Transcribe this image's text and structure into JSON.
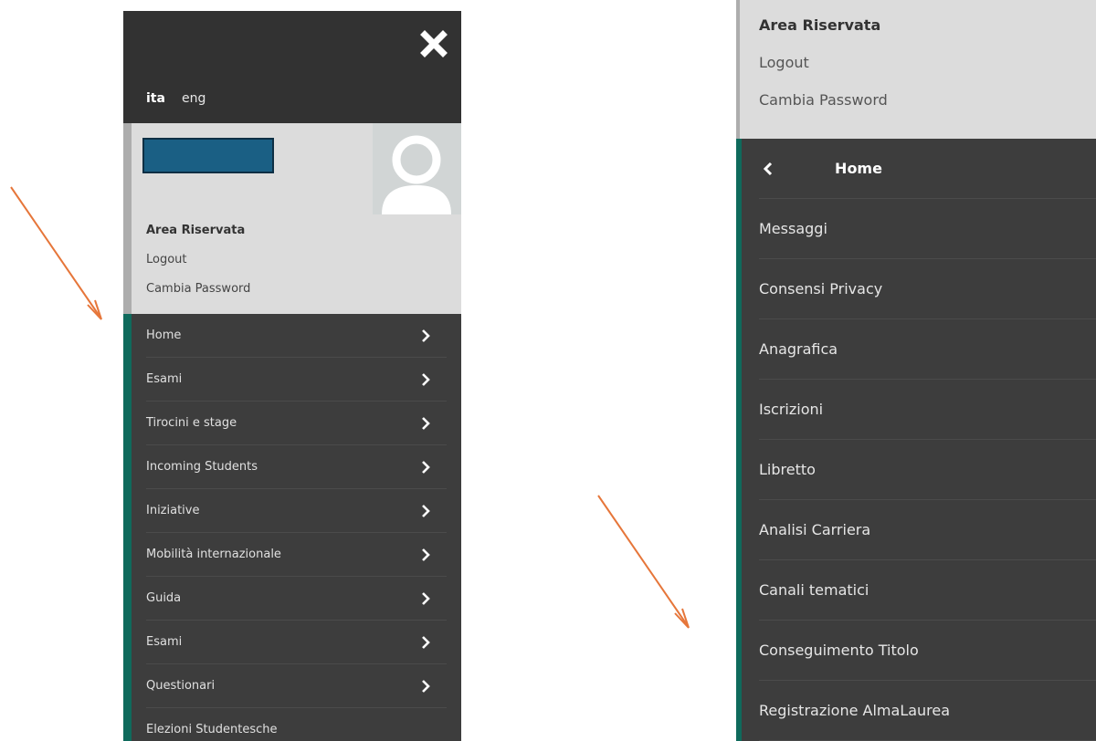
{
  "left_panel": {
    "languages": [
      {
        "label": "ita",
        "active": true
      },
      {
        "label": "eng",
        "active": false
      }
    ],
    "user_area": {
      "title": "Area Riservata",
      "logout": "Logout",
      "change_password": "Cambia Password"
    },
    "menu_items": [
      {
        "label": "Home"
      },
      {
        "label": "Esami"
      },
      {
        "label": "Tirocini e stage"
      },
      {
        "label": "Incoming Students"
      },
      {
        "label": "Iniziative"
      },
      {
        "label": "Mobilità internazionale"
      },
      {
        "label": "Guida"
      },
      {
        "label": "Esami"
      },
      {
        "label": "Questionari"
      },
      {
        "label": "Elezioni Studentesche"
      }
    ]
  },
  "right_panel": {
    "user_area": {
      "title": "Area Riservata",
      "logout": "Logout",
      "change_password": "Cambia Password"
    },
    "header_title": "Home",
    "menu_items": [
      {
        "label": "Messaggi"
      },
      {
        "label": "Consensi Privacy"
      },
      {
        "label": "Anagrafica"
      },
      {
        "label": "Iscrizioni"
      },
      {
        "label": "Libretto"
      },
      {
        "label": "Analisi Carriera"
      },
      {
        "label": "Canali tematici"
      },
      {
        "label": "Conseguimento Titolo"
      },
      {
        "label": "Registrazione AlmaLaurea"
      }
    ]
  },
  "colors": {
    "menu_bg": "#3d3d3d",
    "accent_green": "#0f6a5c",
    "user_area_bg": "#dcdcdc",
    "name_box": "#1a5f84",
    "annotation_arrow": "#e6763a"
  }
}
